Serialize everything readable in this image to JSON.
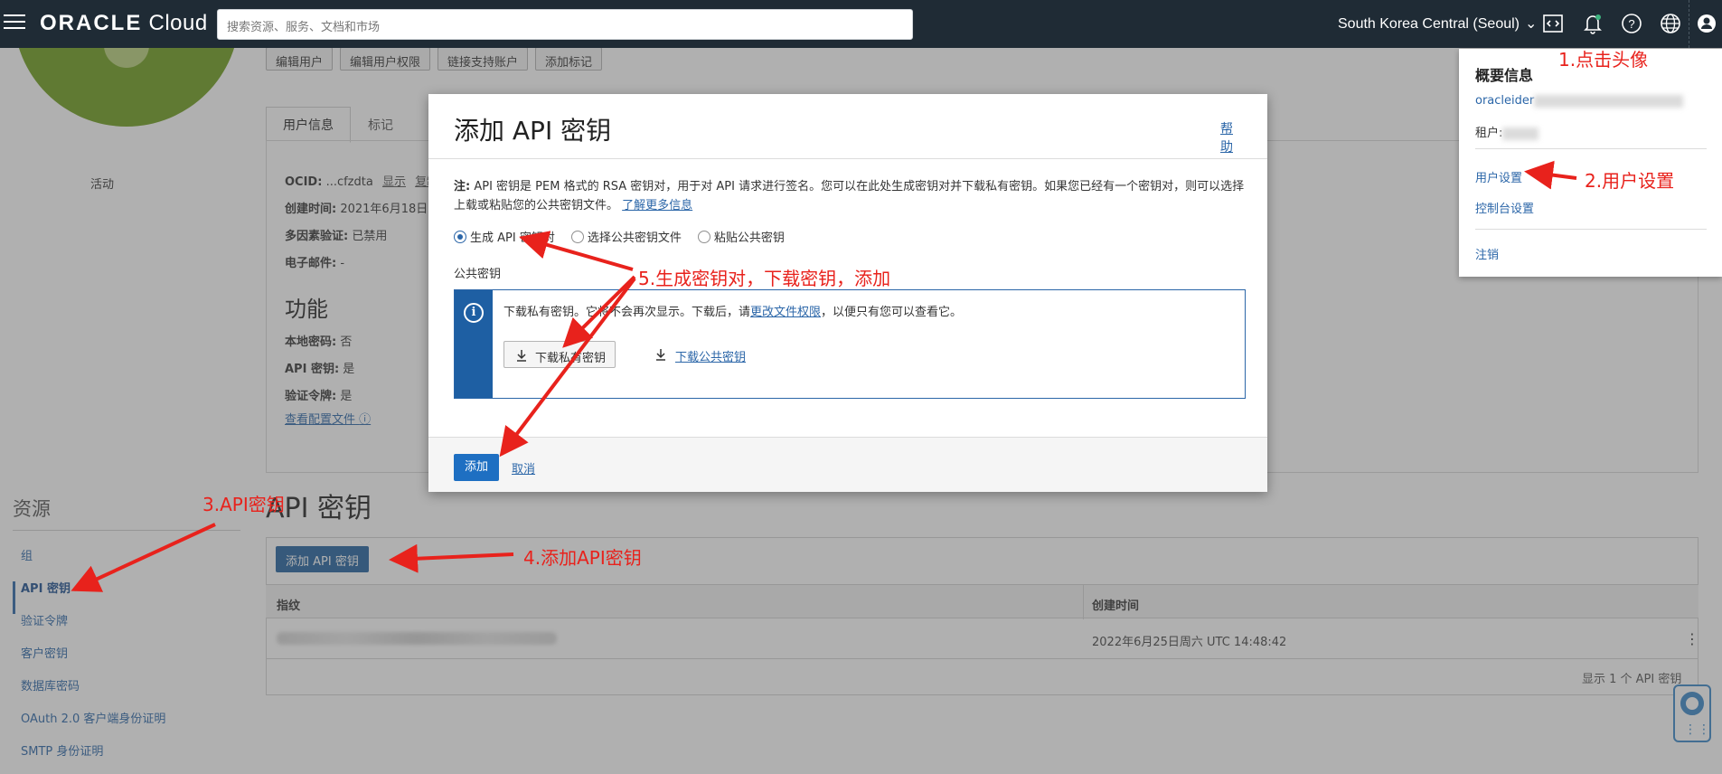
{
  "topbar": {
    "logo_brand": "ORACLE",
    "logo_product": "Cloud",
    "search_placeholder": "搜索资源、服务、文档和市场",
    "region": "South Korea Central (Seoul)",
    "icons": [
      "code-editor-icon",
      "bell-icon",
      "help-icon",
      "globe-icon",
      "user-icon"
    ]
  },
  "profile_page": {
    "status": "活动",
    "actions": [
      "编辑用户",
      "编辑用户权限",
      "链接支持账户",
      "添加标记"
    ],
    "tabs": [
      "用户信息",
      "标记"
    ],
    "info": {
      "ocid_label": "OCID:",
      "ocid_value": "...cfzdta",
      "ocid_show": "显示",
      "ocid_copy": "复制",
      "created_label": "创建时间:",
      "created_value": "2021年6月18日",
      "mfa_label": "多因素验证:",
      "mfa_value": "已禁用",
      "email_label": "电子邮件:",
      "email_value": "-"
    },
    "features_title": "功能",
    "features": {
      "local_pw_label": "本地密码:",
      "local_pw_value": "否",
      "api_key_label": "API 密钥:",
      "api_key_value": "是",
      "auth_token_label": "验证令牌:",
      "auth_token_value": "是",
      "view_config": "查看配置文件"
    }
  },
  "resources": {
    "title": "资源",
    "items": [
      "组",
      "API 密钥",
      "验证令牌",
      "客户密钥",
      "数据库密码",
      "OAuth 2.0 客户端身份证明",
      "SMTP 身份证明"
    ],
    "active_index": 1
  },
  "api_keys": {
    "title": "API 密钥",
    "add_button": "添加 API 密钥",
    "columns": [
      "指纹",
      "创建时间"
    ],
    "rows": [
      {
        "created": "2022年6月25日周六 UTC 14:48:42"
      }
    ],
    "count_text": "显示 1 个 API 密钥"
  },
  "profile_menu": {
    "title": "概要信息",
    "user_prefix": "oracleider",
    "tenant_label": "租户:",
    "user_settings": "用户设置",
    "console_settings": "控制台设置",
    "sign_out": "注销"
  },
  "modal": {
    "title": "添加 API 密钥",
    "help": "帮助",
    "note_label": "注:",
    "note_text": "API 密钥是 PEM 格式的 RSA 密钥对，用于对 API 请求进行签名。您可以在此处生成密钥对并下载私有密钥。如果您已经有一个密钥对，则可以选择上载或粘贴您的公共密钥文件。",
    "note_link": "了解更多信息",
    "radios": [
      "生成 API 密钥对",
      "选择公共密钥文件",
      "粘贴公共密钥"
    ],
    "selected_radio": 0,
    "public_key_label": "公共密钥",
    "info_text_a": "下载私有密钥。它将不会再次显示。下载后，请",
    "info_link": "更改文件权限",
    "info_text_b": "，以便只有您可以查看它。",
    "download_private": "下载私有密钥",
    "download_public": "下载公共密钥",
    "add": "添加",
    "cancel": "取消"
  },
  "annotations": {
    "step1": "1.点击头像",
    "step2": "2.用户设置",
    "step3": "3.API密钥",
    "step4": "4.添加API密钥",
    "step5": "5.生成密钥对，下载密钥，添加",
    "color": "#e8221c"
  }
}
